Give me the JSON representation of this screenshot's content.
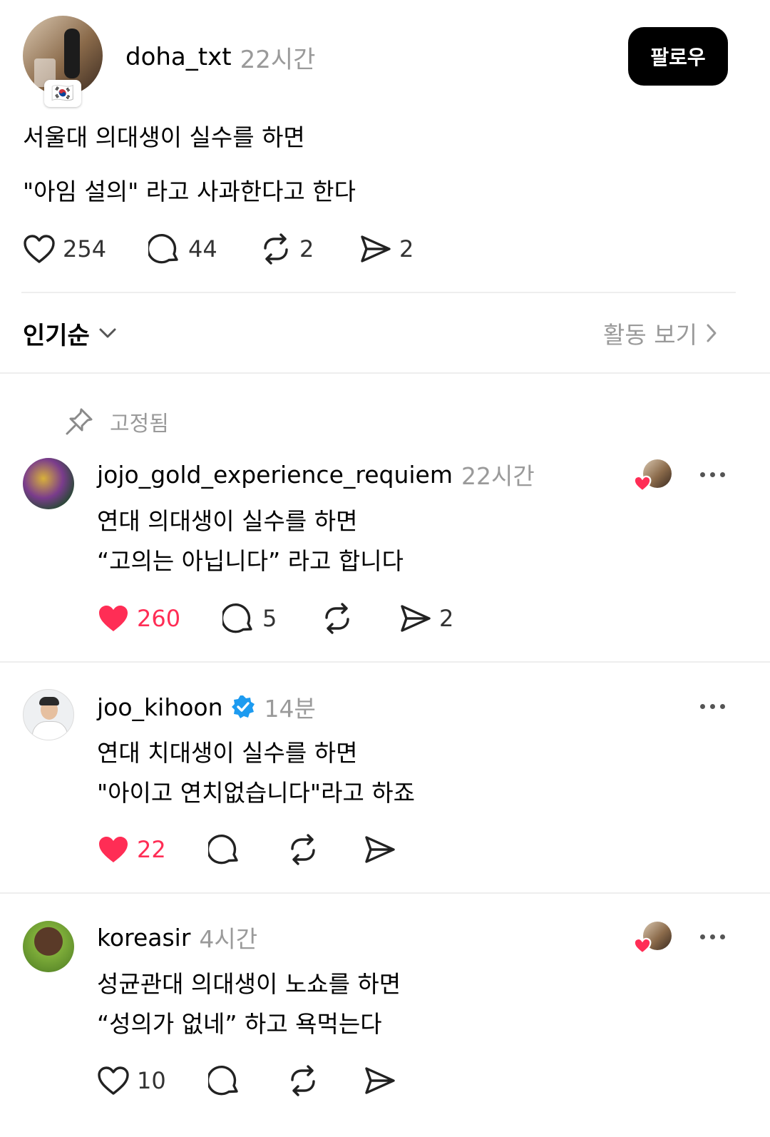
{
  "post": {
    "username": "doha_txt",
    "time": "22시간",
    "follow_label": "팔로우",
    "flag": "🇰🇷",
    "line1": "서울대 의대생이 실수를 하면",
    "line2": "\"아임 설의\" 라고 사과한다고 한다",
    "likes": "254",
    "comments": "44",
    "reposts": "2",
    "shares": "2"
  },
  "sort_bar": {
    "sort_label": "인기순",
    "activity_label": "활동 보기"
  },
  "pinned_label": "고정됨",
  "replies": [
    {
      "username": "jojo_gold_experience_requiem",
      "time": "22시간",
      "line1": "연대 의대생이 실수를 하면",
      "line2": "“고의는 아닙니다” 라고 합니다",
      "likes": "260",
      "liked": true,
      "comments": "5",
      "reposts": "",
      "shares": "2"
    },
    {
      "username": "joo_kihoon",
      "verified": true,
      "time": "14분",
      "line1": "연대 치대생이 실수를 하면",
      "line2": "\"아이고 연치없습니다\"라고 하죠",
      "likes": "22",
      "liked": true,
      "comments": "",
      "reposts": "",
      "shares": ""
    },
    {
      "username": "koreasir",
      "time": "4시간",
      "line1": "성균관대 의대생이 노쇼를 하면",
      "line2": "“성의가 없네” 하고 욕먹는다",
      "likes": "10",
      "liked": false,
      "comments": "",
      "reposts": "",
      "shares": ""
    }
  ],
  "colors": {
    "like_red": "#ff2d55",
    "muted": "#9a9a9a",
    "verified_blue": "#1d9bf0",
    "button_bg": "#000000"
  },
  "icons": [
    "heart-icon",
    "comment-icon",
    "repost-icon",
    "share-icon",
    "pin-icon",
    "chevron-down-icon",
    "chevron-right-icon",
    "more-icon",
    "verified-icon"
  ]
}
